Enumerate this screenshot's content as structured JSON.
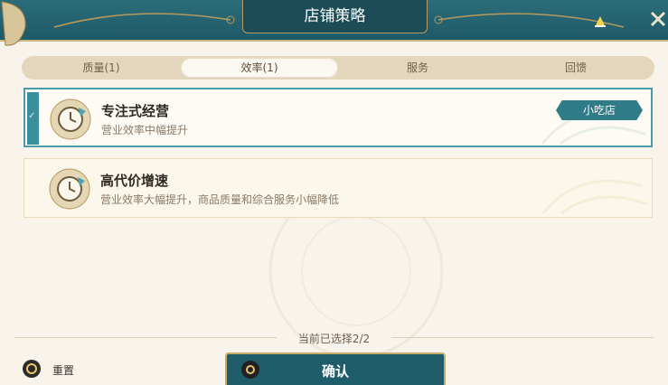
{
  "header": {
    "title": "店铺策略"
  },
  "tabs": [
    {
      "label": "质量(1)",
      "active": false
    },
    {
      "label": "效率(1)",
      "active": true
    },
    {
      "label": "服务",
      "active": false
    },
    {
      "label": "回馈",
      "active": false
    }
  ],
  "strategies": [
    {
      "name": "专注式经营",
      "description": "营业效率中幅提升",
      "selected": true,
      "tag": "小吃店"
    },
    {
      "name": "高代价增速",
      "description": "营业效率大幅提升，商品质量和综合服务小幅降低",
      "selected": false
    }
  ],
  "footer": {
    "selected_count": "当前已选择2/2",
    "reset_label": "重置",
    "confirm_label": "确认"
  },
  "colors": {
    "teal": "#1f5966",
    "gold": "#c9b383",
    "accent": "#3b8f9c"
  },
  "icons": [
    "character-deco-icon",
    "bell-icon",
    "close-icon",
    "strategy-clock-icon",
    "reset-icon",
    "confirm-key-icon"
  ]
}
